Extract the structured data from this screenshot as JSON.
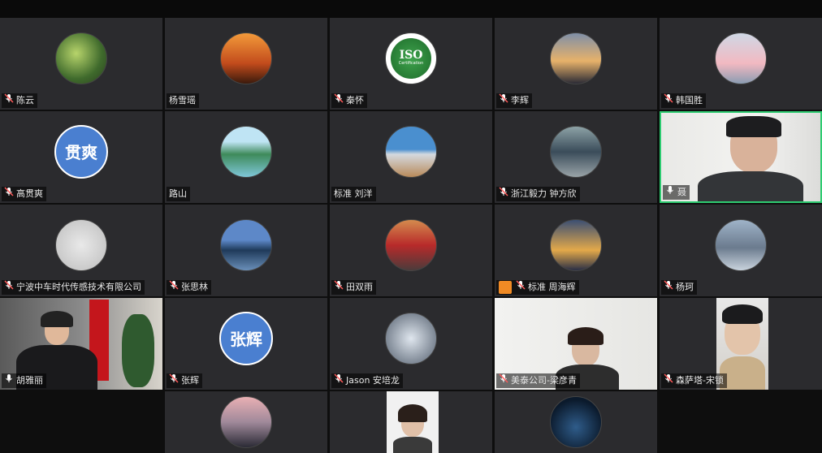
{
  "participants": [
    {
      "name": "陈云",
      "mic": "muted",
      "avatar": "forest"
    },
    {
      "name": "杨雪瑶",
      "mic": "none",
      "avatar": "sunset-tower"
    },
    {
      "name": "秦怀",
      "mic": "muted",
      "avatar": "iso-logo",
      "avatar_text": "ISO",
      "avatar_subtext": "Certification"
    },
    {
      "name": "李辉",
      "mic": "muted",
      "avatar": "dandelion"
    },
    {
      "name": "韩国胜",
      "mic": "muted",
      "avatar": "astronaut"
    },
    {
      "name": "高贯爽",
      "mic": "muted",
      "avatar": "initials",
      "avatar_text": "贯爽"
    },
    {
      "name": "路山",
      "mic": "none",
      "avatar": "karst-river"
    },
    {
      "name": "标准 刘洋",
      "mic": "none",
      "avatar": "beach"
    },
    {
      "name": "浙江毅力 钟方欣",
      "mic": "muted",
      "avatar": "runner"
    },
    {
      "name": "聂",
      "mic": "active",
      "avatar": "video-man"
    },
    {
      "name": "宁波中车时代传感技术有限公司",
      "mic": "muted",
      "avatar": "branches"
    },
    {
      "name": "张思林",
      "mic": "muted",
      "avatar": "city-lake"
    },
    {
      "name": "田双雨",
      "mic": "muted",
      "avatar": "flowers"
    },
    {
      "name": "标准 周海辉",
      "mic": "muted",
      "avatar": "gold-mountain",
      "badge": "orange-person"
    },
    {
      "name": "杨珂",
      "mic": "muted",
      "avatar": "snow-peak"
    },
    {
      "name": "胡雅丽",
      "mic": "unmuted",
      "avatar": "video-woman-flag"
    },
    {
      "name": "张辉",
      "mic": "muted",
      "avatar": "initials",
      "avatar_text": "张辉"
    },
    {
      "name": "Jason 安培龙",
      "mic": "muted",
      "avatar": "eagle"
    },
    {
      "name": "美泰公司-梁彦青",
      "mic": "muted",
      "avatar": "video-woman-room"
    },
    {
      "name": "森萨塔-宋锁",
      "mic": "muted",
      "avatar": "video-young-man"
    },
    {
      "name": "",
      "mic": "none",
      "avatar": "mountain-dusk"
    },
    {
      "name": "",
      "mic": "none",
      "avatar": "video-woman-bottom"
    },
    {
      "name": "",
      "mic": "none",
      "avatar": "planet-figure"
    }
  ],
  "colors": {
    "tile_bg": "#2b2b2e",
    "active_border": "#2ecc71",
    "initials_bg": "#4a7fd0",
    "badge": "#f08a24"
  }
}
